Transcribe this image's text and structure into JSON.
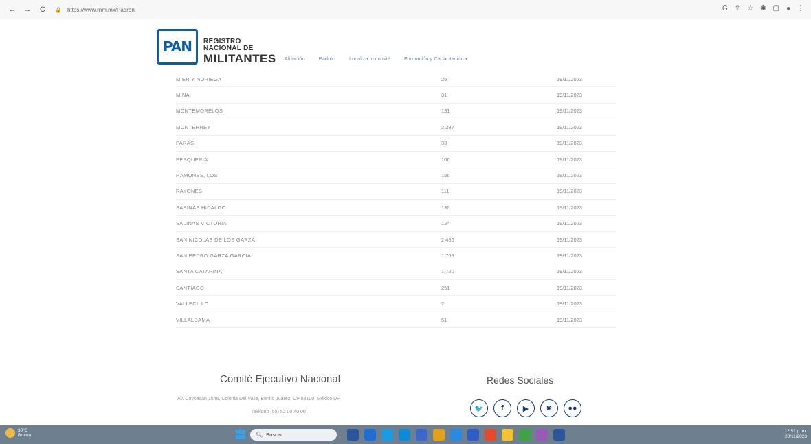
{
  "browser": {
    "url": "https://www.rnm.mx/Padron"
  },
  "site": {
    "logo_text": "PAN",
    "brand_line1": "REGISTRO",
    "brand_line2": "NACIONAL DE",
    "brand_line3": "MILITANTES",
    "nav": [
      "Afiliación",
      "Padrón",
      "Localiza tu comité",
      "Formación y Capacitación ▾"
    ]
  },
  "table": {
    "rows": [
      {
        "name": "MIER Y NORIEGA",
        "count": "25",
        "date": "19/11/2023"
      },
      {
        "name": "MINA",
        "count": "31",
        "date": "19/11/2023"
      },
      {
        "name": "MONTEMORELOS",
        "count": "131",
        "date": "19/11/2023"
      },
      {
        "name": "MONTERREY",
        "count": "2,297",
        "date": "19/11/2023"
      },
      {
        "name": "PARAS",
        "count": "33",
        "date": "19/11/2023"
      },
      {
        "name": "PESQUERIA",
        "count": "106",
        "date": "19/11/2023"
      },
      {
        "name": "RAMONES, LOS",
        "count": "156",
        "date": "19/11/2023"
      },
      {
        "name": "RAYONES",
        "count": "111",
        "date": "19/11/2023"
      },
      {
        "name": "SABINAS HIDALGO",
        "count": "130",
        "date": "19/11/2023"
      },
      {
        "name": "SALINAS VICTORIA",
        "count": "124",
        "date": "19/11/2023"
      },
      {
        "name": "SAN NICOLAS DE LOS GARZA",
        "count": "2,486",
        "date": "19/11/2023"
      },
      {
        "name": "SAN PEDRO GARZA GARCIA",
        "count": "1,769",
        "date": "19/11/2023"
      },
      {
        "name": "SANTA CATARINA",
        "count": "1,720",
        "date": "19/11/2023"
      },
      {
        "name": "SANTIAGO",
        "count": "251",
        "date": "19/11/2023"
      },
      {
        "name": "VALLECILLO",
        "count": "2",
        "date": "19/11/2023"
      },
      {
        "name": "VILLALDAMA",
        "count": "51",
        "date": "19/11/2023"
      }
    ]
  },
  "footer": {
    "left_title": "Comité Ejecutivo Nacional",
    "address": "Av. Coyoacán 1546, Colonia Del Valle, Benito Juárez, CP 03100, México DF",
    "phone": "Teléfono (55) 52 00 40 00",
    "right_title": "Redes Sociales",
    "socials": [
      {
        "icon": "twitter-icon",
        "glyph": "🐦"
      },
      {
        "icon": "facebook-icon",
        "glyph": "f"
      },
      {
        "icon": "youtube-icon",
        "glyph": "▶"
      },
      {
        "icon": "instagram-icon",
        "glyph": "◙"
      },
      {
        "icon": "flickr-icon",
        "glyph": "●●"
      }
    ]
  },
  "taskbar": {
    "temp": "30°C",
    "weather": "Bruma",
    "search_label": "Buscar",
    "time": "12:51 p. m.",
    "date": "20/11/2023",
    "icon_colors": [
      "#2b579a",
      "#1f6fd1",
      "#1b9be0",
      "#0f8ad6",
      "#3c68c9",
      "#e0a21b",
      "#2a8adf",
      "#2d5ec8",
      "#e34b2b",
      "#f2c231",
      "#3fa346",
      "#9b59b6",
      "#2b579a"
    ]
  }
}
